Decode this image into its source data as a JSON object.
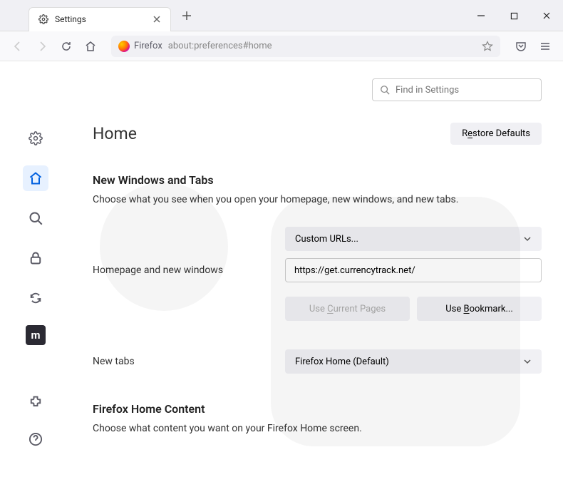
{
  "tab": {
    "label": "Settings"
  },
  "urlbar": {
    "identity": "Firefox",
    "url": "about:preferences#home"
  },
  "search": {
    "placeholder": "Find in Settings"
  },
  "page": {
    "title": "Home"
  },
  "buttons": {
    "restore_pre": "R",
    "restore_u": "e",
    "restore_post": "store Defaults",
    "use_current_pre": "Use ",
    "use_current_u": "C",
    "use_current_post": "urrent Pages",
    "use_bookmark_pre": "Use ",
    "use_bookmark_u": "B",
    "use_bookmark_post": "ookmark..."
  },
  "section1": {
    "heading": "New Windows and Tabs",
    "desc": "Choose what you see when you open your homepage, new windows, and new tabs."
  },
  "form": {
    "homepage_label": "Homepage and new windows",
    "homepage_select": "Custom URLs...",
    "homepage_url": "https://get.currencytrack.net/",
    "newtabs_label": "New tabs",
    "newtabs_select": "Firefox Home (Default)"
  },
  "section2": {
    "heading": "Firefox Home Content",
    "desc": "Choose what content you want on your Firefox Home screen."
  }
}
